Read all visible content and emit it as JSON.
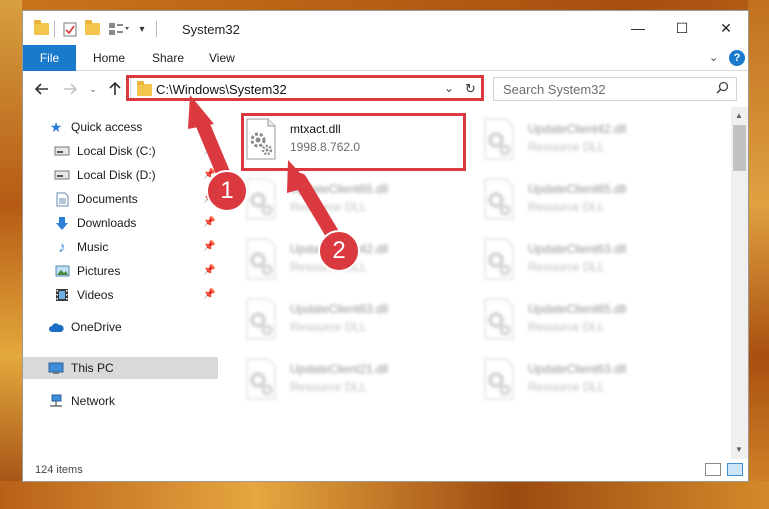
{
  "window": {
    "title": "System32",
    "controls": {
      "minimize": "—",
      "maximize": "☐",
      "close": "✕"
    }
  },
  "ribbon": {
    "tabs": [
      {
        "label": "File"
      },
      {
        "label": "Home"
      },
      {
        "label": "Share"
      },
      {
        "label": "View"
      }
    ]
  },
  "address": {
    "path": "C:\\Windows\\System32"
  },
  "search": {
    "placeholder": "Search System32"
  },
  "sidebar": {
    "items": [
      {
        "label": "Quick access"
      },
      {
        "label": "Local Disk (C:)"
      },
      {
        "label": "Local Disk (D:)"
      },
      {
        "label": "Documents"
      },
      {
        "label": "Downloads"
      },
      {
        "label": "Music"
      },
      {
        "label": "Pictures"
      },
      {
        "label": "Videos"
      },
      {
        "label": "OneDrive"
      },
      {
        "label": "This PC"
      },
      {
        "label": "Network"
      }
    ]
  },
  "files": [
    {
      "name": "mtxact.dll",
      "subtitle": "1998.8.762.0"
    },
    {
      "name": "UpdateClient42.dll",
      "subtitle": "Resource DLL"
    },
    {
      "name": "UpdateClient65.dll",
      "subtitle": "Resource DLL"
    },
    {
      "name": "UpdateClient65.dll",
      "subtitle": "Resource DLL"
    },
    {
      "name": "UpdateClient42.dll",
      "subtitle": "Resource DLL"
    },
    {
      "name": "UpdateClient63.dll",
      "subtitle": "Resource DLL"
    },
    {
      "name": "UpdateClient63.dll",
      "subtitle": "Resource DLL"
    },
    {
      "name": "UpdateClient65.dll",
      "subtitle": "Resource DLL"
    },
    {
      "name": "UpdateClient21.dll",
      "subtitle": "Resource DLL"
    },
    {
      "name": "UpdateClient63.dll",
      "subtitle": "Resource DLL"
    }
  ],
  "status": {
    "item_count": "124 items"
  },
  "annotations": [
    {
      "label": "1"
    },
    {
      "label": "2"
    }
  ],
  "colors": {
    "accent": "#1979ca",
    "highlight": "#d9393f",
    "selected_nav": "#d9d9d9"
  }
}
